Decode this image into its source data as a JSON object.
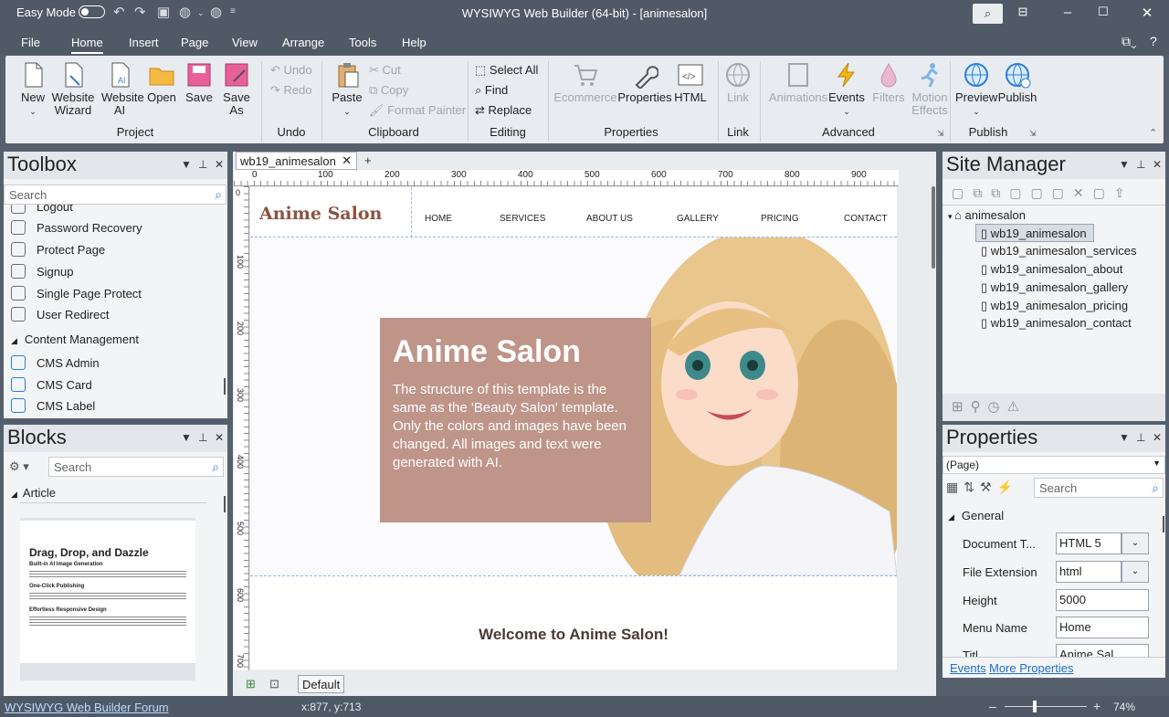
{
  "titlebar": {
    "easy_mode": "Easy Mode",
    "title": "WYSIWYG Web Builder (64-bit) - [animesalon]"
  },
  "menu": [
    "File",
    "Home",
    "Insert",
    "Page",
    "View",
    "Arrange",
    "Tools",
    "Help"
  ],
  "ribbon": {
    "project": {
      "new": "New",
      "website_wizard": "Website Wizard",
      "website_ai": "Website AI",
      "open": "Open",
      "save": "Save",
      "save_as": "Save As",
      "label": "Project"
    },
    "undo": {
      "undo": "Undo",
      "redo": "Redo",
      "label": "Undo"
    },
    "clipboard": {
      "paste": "Paste",
      "cut": "Cut",
      "copy": "Copy",
      "format_painter": "Format Painter",
      "label": "Clipboard"
    },
    "editing": {
      "select_all": "Select All",
      "find": "Find",
      "replace": "Replace",
      "label": "Editing"
    },
    "properties": {
      "ecommerce": "Ecommerce",
      "properties": "Properties",
      "html": "HTML",
      "label": "Properties"
    },
    "link": {
      "link": "Link",
      "label": "Link"
    },
    "advanced": {
      "animations": "Animations",
      "events": "Events",
      "filters": "Filters",
      "motion_effects": "Motion Effects",
      "label": "Advanced"
    },
    "publish": {
      "preview": "Preview",
      "publish": "Publish",
      "label": "Publish"
    }
  },
  "toolbox": {
    "title": "Toolbox",
    "search_placeholder": "Search",
    "items": [
      "Logout",
      "Password Recovery",
      "Protect Page",
      "Signup",
      "Single Page Protect",
      "User Redirect"
    ],
    "section": "Content Management",
    "cms_items": [
      "CMS Admin",
      "CMS Card",
      "CMS Label"
    ]
  },
  "blocks": {
    "title": "Blocks",
    "search_placeholder": "Search",
    "section": "Article",
    "preview_title": "Drag, Drop, and Dazzle",
    "preview_h1": "Built-in AI Image Generation",
    "preview_h2": "One-Click Publishing",
    "preview_h3": "Effortless Responsive Design"
  },
  "document": {
    "tab": "wb19_animesalon",
    "ruler_marks": [
      "0",
      "100",
      "200",
      "300",
      "400",
      "500",
      "600",
      "700",
      "800",
      "900"
    ],
    "vruler_marks": [
      "0",
      "100",
      "200",
      "300",
      "400",
      "500",
      "600",
      "700"
    ],
    "layout": "Default"
  },
  "site": {
    "logo": "Anime Salon",
    "nav": [
      "HOME",
      "SERVICES",
      "ABOUT US",
      "GALLERY",
      "PRICING",
      "CONTACT"
    ],
    "hero_title": "Anime Salon",
    "hero_text": "The structure of this template is the same as the 'Beauty Salon' template. Only the colors and images have been changed. All images and text were generated with AI.",
    "welcome": "Welcome to Anime Salon!"
  },
  "site_manager": {
    "title": "Site Manager",
    "root": "animesalon",
    "pages": [
      "wb19_animesalon",
      "wb19_animesalon_services",
      "wb19_animesalon_about",
      "wb19_animesalon_gallery",
      "wb19_animesalon_pricing",
      "wb19_animesalon_contact"
    ]
  },
  "properties": {
    "title": "Properties",
    "object": "(Page)",
    "search_placeholder": "Search",
    "section": "General",
    "rows": [
      {
        "label": "Document T...",
        "value": "HTML 5"
      },
      {
        "label": "File Extension",
        "value": "html"
      },
      {
        "label": "Height",
        "value": "5000"
      },
      {
        "label": "Menu Name",
        "value": "Home"
      },
      {
        "label": "Titl",
        "value": "Anime Sal"
      }
    ],
    "events_link": "Events",
    "more_link": "More Properties"
  },
  "status": {
    "forum": "WYSIWYG Web Builder Forum",
    "coords": "x:877, y:713",
    "zoom": "74%"
  },
  "colors": {
    "chrome": "#4f5a66",
    "hero": "#bf958a",
    "logo": "#8a5440"
  }
}
